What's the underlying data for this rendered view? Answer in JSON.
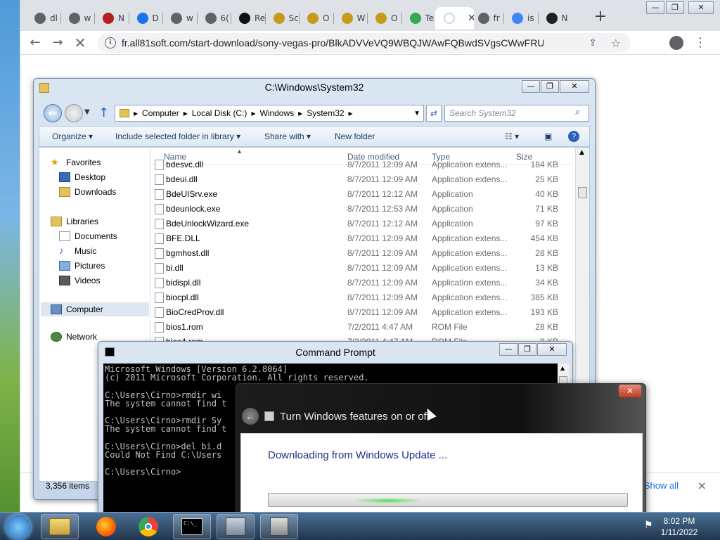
{
  "browser": {
    "tabs": [
      {
        "title": "dl",
        "icon": "chrome-icon",
        "fav_color": "#5f6368"
      },
      {
        "title": "w",
        "icon": "chrome-icon",
        "fav_color": "#5f6368"
      },
      {
        "title": "N",
        "icon": "app-icon",
        "fav_color": "#b51f1f"
      },
      {
        "title": "D",
        "icon": "download-icon",
        "fav_color": "#1a73e8"
      },
      {
        "title": "w",
        "icon": "chrome-icon",
        "fav_color": "#5f6368"
      },
      {
        "title": "6(",
        "icon": "chrome-icon",
        "fav_color": "#5f6368"
      },
      {
        "title": "Re",
        "icon": "github-icon",
        "fav_color": "#111111"
      },
      {
        "title": "Sc",
        "icon": "g-icon",
        "fav_color": "#c79a1c"
      },
      {
        "title": "O",
        "icon": "g-icon",
        "fav_color": "#c79a1c"
      },
      {
        "title": "W",
        "icon": "g-icon",
        "fav_color": "#c79a1c"
      },
      {
        "title": "O",
        "icon": "g-icon",
        "fav_color": "#c79a1c"
      },
      {
        "title": "Te",
        "icon": "download-icon",
        "fav_color": "#34a853"
      },
      {
        "title": "",
        "icon": "loading-icon",
        "fav_color": "#c7d7ee"
      },
      {
        "title": "fr",
        "icon": "chrome-icon",
        "fav_color": "#5f6368"
      },
      {
        "title": "is",
        "icon": "google-icon",
        "fav_color": "#4285f4"
      },
      {
        "title": "N",
        "icon": "chrome-icon",
        "fav_color": "#202124"
      }
    ],
    "new_tab_label": "+",
    "url": "fr.all81soft.com/start-download/sony-vegas-pro/BlkADVVeVQ9WBQJWAwFQBwdSVgsCWwFRUFNQA1ECAVVSV...",
    "show_all": "Show all",
    "close_downloads": "×"
  },
  "explorer": {
    "title": "C:\\Windows\\System32",
    "breadcrumb": [
      "Computer",
      "Local Disk (C:)",
      "Windows",
      "System32"
    ],
    "search_placeholder": "Search System32",
    "commands": [
      "Organize ▾",
      "Include selected folder in library ▾",
      "Share with ▾",
      "New folder"
    ],
    "nav": {
      "favorites": "Favorites",
      "desktop": "Desktop",
      "downloads": "Downloads",
      "libraries": "Libraries",
      "documents": "Documents",
      "music": "Music",
      "pictures": "Pictures",
      "videos": "Videos",
      "computer": "Computer",
      "network": "Network"
    },
    "columns": {
      "name": "Name",
      "date": "Date modified",
      "type": "Type",
      "size": "Size"
    },
    "files": [
      {
        "name": "bdesvc.dll",
        "date": "8/7/2011 12:09 AM",
        "type": "Application extens...",
        "size": "184 KB"
      },
      {
        "name": "bdeui.dll",
        "date": "8/7/2011 12:09 AM",
        "type": "Application extens...",
        "size": "25 KB"
      },
      {
        "name": "BdeUISrv.exe",
        "date": "8/7/2011 12:12 AM",
        "type": "Application",
        "size": "40 KB"
      },
      {
        "name": "bdeunlock.exe",
        "date": "8/7/2011 12:53 AM",
        "type": "Application",
        "size": "71 KB"
      },
      {
        "name": "BdeUnlockWizard.exe",
        "date": "8/7/2011 12:12 AM",
        "type": "Application",
        "size": "97 KB"
      },
      {
        "name": "BFE.DLL",
        "date": "8/7/2011 12:09 AM",
        "type": "Application extens...",
        "size": "454 KB"
      },
      {
        "name": "bgmhost.dll",
        "date": "8/7/2011 12:09 AM",
        "type": "Application extens...",
        "size": "28 KB"
      },
      {
        "name": "bi.dll",
        "date": "8/7/2011 12:09 AM",
        "type": "Application extens...",
        "size": "13 KB"
      },
      {
        "name": "bidispl.dll",
        "date": "8/7/2011 12:09 AM",
        "type": "Application extens...",
        "size": "34 KB"
      },
      {
        "name": "biocpl.dll",
        "date": "8/7/2011 12:09 AM",
        "type": "Application extens...",
        "size": "385 KB"
      },
      {
        "name": "BioCredProv.dll",
        "date": "8/7/2011 12:09 AM",
        "type": "Application extens...",
        "size": "193 KB"
      },
      {
        "name": "bios1.rom",
        "date": "7/2/2011 4:47 AM",
        "type": "ROM File",
        "size": "28 KB"
      },
      {
        "name": "bios4.rom",
        "date": "7/2/2011 4:47 AM",
        "type": "ROM File",
        "size": "8 KB"
      }
    ],
    "status": "3,356 items"
  },
  "cmd": {
    "title": "Command Prompt",
    "lines": [
      "Microsoft Windows [Version 6.2.8064]",
      "(c) 2011 Microsoft Corporation. All rights reserved.",
      "",
      "C:\\Users\\Cirno>rmdir wi",
      "The system cannot find t",
      "",
      "C:\\Users\\Cirno>rmdir Sy",
      "The system cannot find t",
      "",
      "C:\\Users\\Cirno>del bi.d",
      "Could Not Find C:\\Users",
      "",
      "C:\\Users\\Cirno>"
    ]
  },
  "features": {
    "title": "Turn Windows features on or off",
    "message": "Downloading from Windows Update ...",
    "close": "✕"
  },
  "taskbar": {
    "time": "8:02 PM",
    "date": "1/11/2022"
  }
}
